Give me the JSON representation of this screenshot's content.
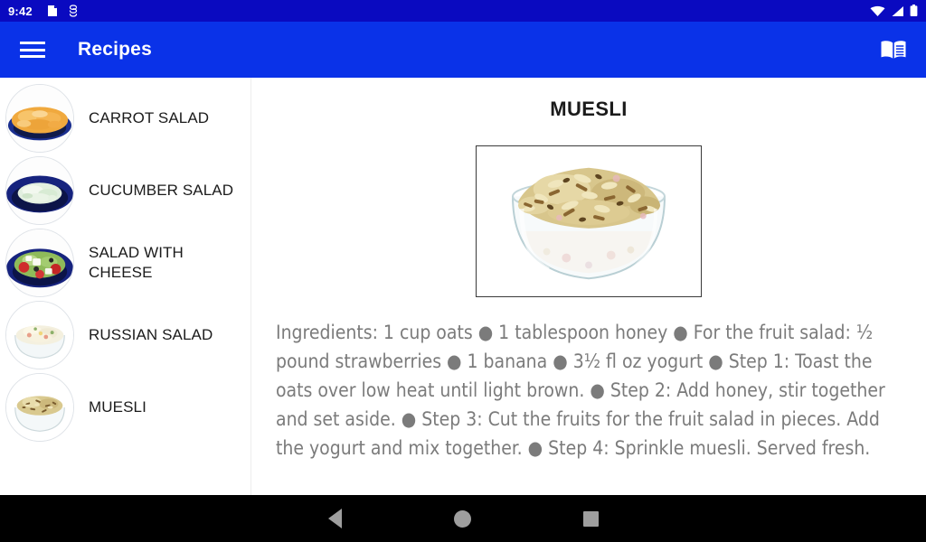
{
  "status_bar": {
    "clock": "9:42",
    "left_icons": [
      "note-icon",
      "stacked-coins-icon"
    ],
    "right_icons": [
      "wifi-icon",
      "cell-signal-icon",
      "battery-icon"
    ],
    "background_color": "#0a0ac0"
  },
  "app_bar": {
    "menu_icon": "hamburger-menu-icon",
    "title": "Recipes",
    "action_icon": "menu-book-icon",
    "background_color": "#0a32e8",
    "text_color": "#ffffff"
  },
  "recipe_list": {
    "items": [
      {
        "label": "CARROT SALAD",
        "thumb": "carrot-salad-thumb",
        "selected": false
      },
      {
        "label": "CUCUMBER SALAD",
        "thumb": "cucumber-salad-thumb",
        "selected": false
      },
      {
        "label": "SALAD WITH CHEESE",
        "thumb": "salad-with-cheese-thumb",
        "selected": false
      },
      {
        "label": "RUSSIAN SALAD",
        "thumb": "russian-salad-thumb",
        "selected": false
      },
      {
        "label": "MUESLI",
        "thumb": "muesli-thumb",
        "selected": true
      }
    ]
  },
  "detail": {
    "title": "MUESLI",
    "image": "muesli-bowl-photo",
    "body": "Ingredients: 1 cup oats ● 1 tablespoon honey ● For the fruit salad: ½ pound strawberries ● 1 banana ● 3½ fl oz yogurt ● Step 1: Toast the oats over low heat until light brown. ● Step 2: Add honey, stir together and set aside. ● Step 3: Cut the fruits for the fruit salad in pieces. Add the yogurt and mix together. ● Step 4: Sprinkle muesli. Served fresh.",
    "text_color": "#7b7b7b"
  },
  "nav_bar": {
    "back_label": "Back",
    "home_label": "Home",
    "recents_label": "Recents",
    "background_color": "#000000",
    "icon_color": "#9e9e9e"
  }
}
